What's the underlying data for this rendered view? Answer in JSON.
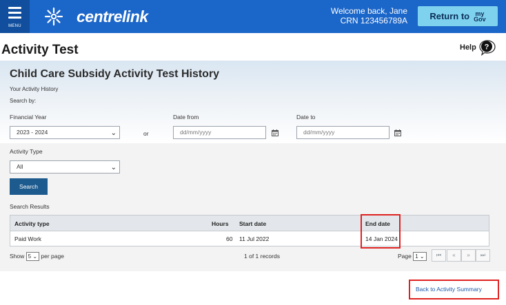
{
  "header": {
    "menu_label": "MENU",
    "brand": "centrelink",
    "welcome_line": "Welcome back, Jane",
    "crn_line": "CRN 123456789A",
    "return_label": "Return to",
    "mygov_top": "my",
    "mygov_bottom": "Gov"
  },
  "page": {
    "title": "Activity Test",
    "help_label": "Help"
  },
  "history": {
    "title": "Child Care Subsidy Activity Test History",
    "subtitle": "Your Activity History",
    "search_by": "Search by:",
    "financial_year_label": "Financial Year",
    "financial_year_value": "2023 - 2024",
    "or_label": "or",
    "date_from_label": "Date from",
    "date_from_placeholder": "dd/mm/yyyy",
    "date_to_label": "Date to",
    "date_to_placeholder": "dd/mm/yyyy",
    "activity_type_label": "Activity Type",
    "activity_type_value": "All",
    "search_button": "Search",
    "results_label": "Search Results"
  },
  "table": {
    "columns": [
      "Activity type",
      "Hours",
      "Start date",
      "End date"
    ],
    "rows": [
      [
        "Paid Work",
        "60",
        "11 Jul 2022",
        "14 Jan 2024"
      ]
    ]
  },
  "pagination": {
    "show_label": "Show",
    "per_page_value": "5",
    "per_page_label": "per page",
    "record_count": "1 of 1 records",
    "page_label": "Page",
    "page_value": "1",
    "first": "⏮",
    "prev": "«",
    "next": "»",
    "last": "⏭"
  },
  "footer": {
    "back_link": "Back to Activity Summary"
  },
  "colors": {
    "brand_blue": "#1b66c9",
    "button_blue": "#1d5a8e",
    "return_button": "#7fd2ee",
    "highlight_red": "#e02020"
  }
}
